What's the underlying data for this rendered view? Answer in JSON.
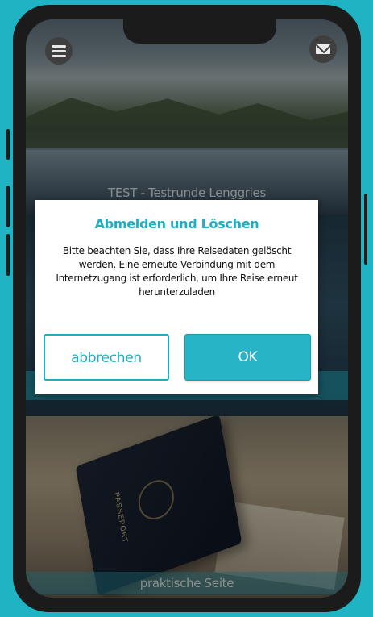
{
  "screen": {
    "panels": [
      {
        "caption": "TEST - Testrunde Lenggries"
      },
      {
        "caption": ""
      },
      {
        "caption": "praktische Seite",
        "image_text": "PASSEPORT"
      }
    ]
  },
  "header": {
    "menu_icon": "hamburger-menu-icon",
    "mail_icon": "envelope-icon"
  },
  "dialog": {
    "title": "Abmelden und Löschen",
    "message": "Bitte beachten Sie, dass Ihre Reisedaten gelöscht werden. Eine erneute Verbindung mit dem Internetzugang ist erforderlich, um Ihre Reise erneut herunterzuladen",
    "cancel_label": "abbrechen",
    "ok_label": "OK"
  },
  "colors": {
    "accent": "#20aec1",
    "background": "#1fb3c3",
    "frame": "#1b1b1b"
  }
}
